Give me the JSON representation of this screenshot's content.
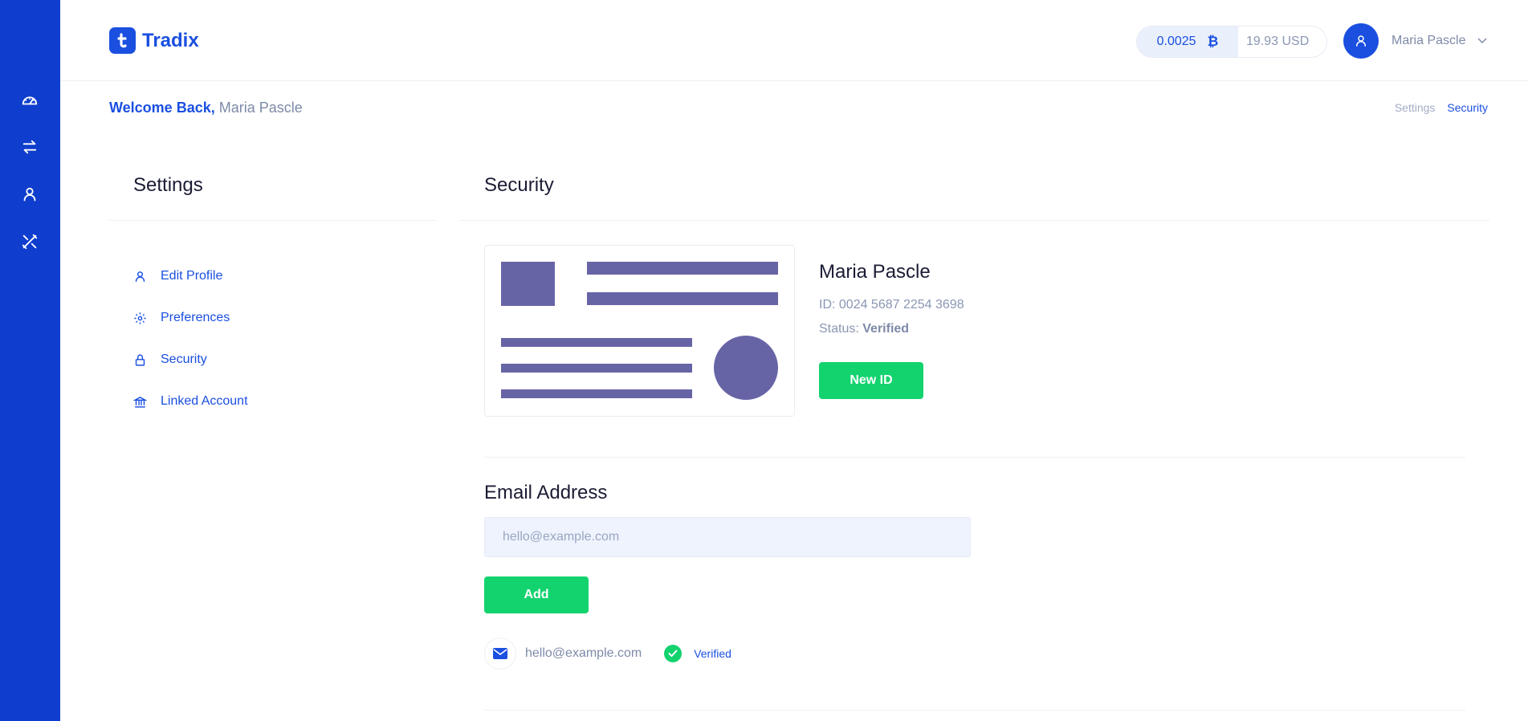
{
  "brand": {
    "name": "Tradix"
  },
  "sidebar": {
    "items": [
      {
        "icon": "speedometer-icon"
      },
      {
        "icon": "exchange-arrows-icon"
      },
      {
        "icon": "user-icon"
      },
      {
        "icon": "tools-icon"
      }
    ]
  },
  "header": {
    "balance_btc": "0.0025",
    "balance_usd": "19.93 USD",
    "user_name": "Maria Pascle"
  },
  "welcome": {
    "greeting": "Welcome Back,",
    "name": "Maria Pascle"
  },
  "breadcrumb": {
    "items": [
      "Settings",
      "Security"
    ]
  },
  "settings": {
    "title": "Settings",
    "nav": [
      {
        "label": "Edit Profile",
        "icon": "user-icon"
      },
      {
        "label": "Preferences",
        "icon": "gear-icon"
      },
      {
        "label": "Security",
        "icon": "lock-icon"
      },
      {
        "label": "Linked Account",
        "icon": "bank-icon"
      }
    ]
  },
  "security": {
    "title": "Security",
    "id_card": {
      "name": "Maria Pascle",
      "id_text": "ID: 0024 5687 2254 3698",
      "status_label": "Status:",
      "status_value": "Verified",
      "button": "New ID"
    },
    "email": {
      "title": "Email Address",
      "placeholder": "hello@example.com",
      "add_button": "Add",
      "entry": "hello@example.com",
      "entry_status": "Verified"
    }
  },
  "colors": {
    "primary": "#1a4fe0",
    "sidebar": "#0f3dcd",
    "success": "#13d36f",
    "card_art": "#6764a6"
  }
}
